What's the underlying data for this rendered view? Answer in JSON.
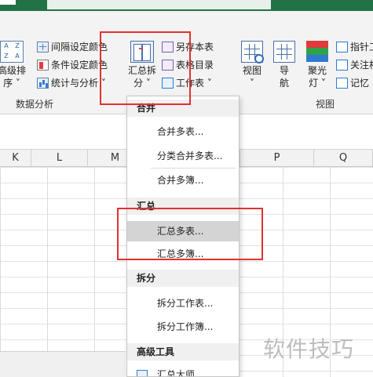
{
  "ribbon": {
    "sort_button": {
      "label_line1": "高级排",
      "label_line2": "序 ˅"
    },
    "sort_icon_letters": [
      "A",
      "Z",
      "Z",
      "A"
    ],
    "small_items": [
      {
        "label": "间隔设定颜色",
        "icon": "grid-icon"
      },
      {
        "label": "条件设定颜色",
        "icon": "conditional-color-icon"
      },
      {
        "label": "统计与分析 ˅",
        "icon": "statistics-icon"
      }
    ],
    "group_data_analysis": "数据分析",
    "merge_button": {
      "label_line1": "汇总拆",
      "label_line2": "分 ˅"
    },
    "sheet_tools": [
      {
        "label": "另存本表",
        "icon": "save-copy-icon"
      },
      {
        "label": "表格目录",
        "icon": "table-directory-icon"
      },
      {
        "label": "工作表 ˅",
        "icon": "worksheet-icon"
      }
    ],
    "view_button": {
      "label_line1": "视图",
      "label_line2": "˅"
    },
    "nav_button": {
      "label_line1": "导",
      "label_line2": "航"
    },
    "spotlight_button": {
      "label_line1": "聚光",
      "label_line2": "灯 ˅"
    },
    "right_items": [
      "指针工",
      "关注相",
      "记忆"
    ],
    "group_view": "视图"
  },
  "sheet": {
    "columns": [
      "K",
      "L",
      "M",
      "P",
      "Q"
    ]
  },
  "menu": {
    "sections": [
      {
        "title": "合并",
        "items": [
          "合并多表...",
          "分类合并多表...",
          "合并多簿..."
        ]
      },
      {
        "title": "汇总",
        "items": [
          "汇总多表...",
          "汇总多簿..."
        ]
      },
      {
        "title": "拆分",
        "items": [
          "拆分工作表...",
          "拆分工作簿..."
        ]
      },
      {
        "title": "高级工具",
        "items": [
          "汇总大师"
        ]
      }
    ]
  },
  "watermark": "软件技巧",
  "colors": {
    "highlight_box": "#e3312f",
    "menu_hover": "#d4d4d4",
    "title_green": "#217346"
  }
}
